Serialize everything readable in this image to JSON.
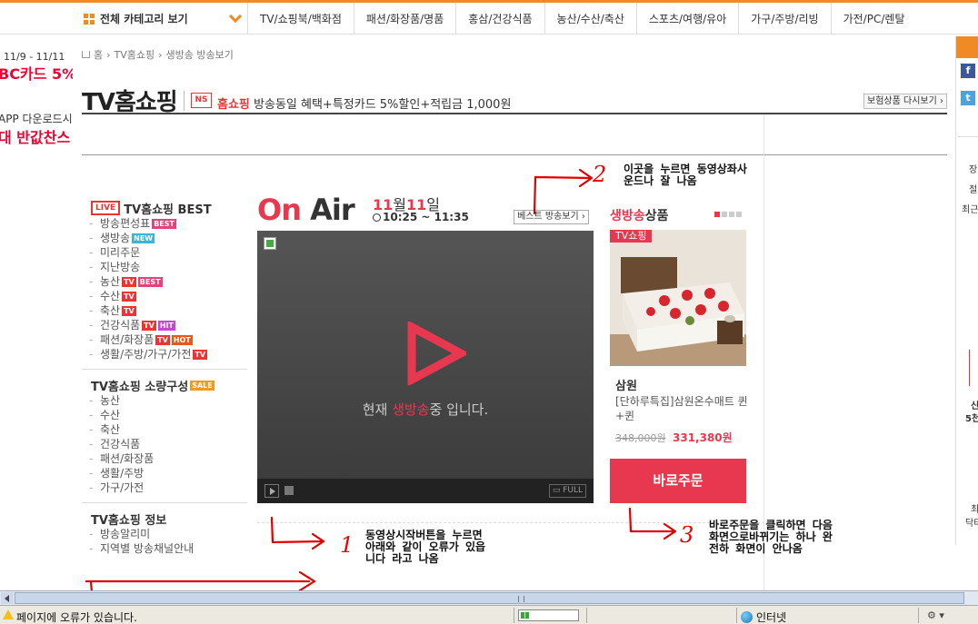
{
  "nav": {
    "all_categories": "전체 카테고리 보기",
    "items": [
      "TV/쇼핑북/백화점",
      "패션/화장품/명품",
      "홍삼/건강식품",
      "농산/수산/축산",
      "스포츠/여행/유아",
      "가구/주방/리빙",
      "가전/PC/렌탈"
    ]
  },
  "left_banner": {
    "line1": "11/9 - 11/11",
    "line2": "BC카드 5%",
    "line3": "APP 다운로드시",
    "line4": "대 반값찬스"
  },
  "breadcrumb": {
    "home": "홈",
    "level1": "TV홈쇼핑",
    "level2": "생방송 방송보기"
  },
  "header": {
    "title": "TV홈쇼핑",
    "logo_text": "NS",
    "brand": "홈쇼핑",
    "promo": "방송동일 혜택+특정카드 5%할인+적립금 1,000원",
    "insurance_button": "보험상품 다시보기"
  },
  "left_menu": {
    "best_badge": "LIVE",
    "best_title": "TV홈쇼핑 BEST",
    "best_items": [
      {
        "label": "방송편성표",
        "tags": [
          "BEST"
        ]
      },
      {
        "label": "생방송",
        "tags": [
          "NEW"
        ]
      },
      {
        "label": "미리주문",
        "tags": []
      },
      {
        "label": "지난방송",
        "tags": []
      },
      {
        "label": "농산",
        "tags": [
          "TV",
          "BEST"
        ]
      },
      {
        "label": "수산",
        "tags": [
          "TV"
        ]
      },
      {
        "label": "축산",
        "tags": [
          "TV"
        ]
      },
      {
        "label": "건강식품",
        "tags": [
          "TV",
          "HIT"
        ]
      },
      {
        "label": "패션/화장품",
        "tags": [
          "TV",
          "HOT"
        ]
      },
      {
        "label": "생활/주방/가구/가전",
        "tags": [
          "TV"
        ]
      }
    ],
    "small_title": "TV홈쇼핑 소량구성",
    "small_tag": "SALE",
    "small_items": [
      "농산",
      "수산",
      "축산",
      "건강식품",
      "패션/화장품",
      "생활/주방",
      "가구/가전"
    ],
    "info_title": "TV홈쇼핑 정보",
    "info_items": [
      "방송알리미",
      "지역별 방송채널안내"
    ]
  },
  "onair": {
    "on": "On",
    "air": "Air",
    "month": "11",
    "month_unit": "월",
    "day": "11",
    "day_unit": "일",
    "time": "10:25 ~ 11:35",
    "best_button": "베스트 방송보기"
  },
  "video": {
    "msg_prefix": "현재 ",
    "msg_live": "생방송",
    "msg_suffix": "중 입니다.",
    "full_label": "FULL"
  },
  "live_product": {
    "head_red": "생방송",
    "head_rest": "상품",
    "tv_tag": "TV쇼핑",
    "brand": "삼원",
    "name": "[단하루특집]삼원온수매트 퀸+퀸",
    "orig_price": "348,000원",
    "sale_price": "331,380원",
    "order_button": "바로주문"
  },
  "right_panel": {
    "t1": "장",
    "t2": "절",
    "t3": "최근",
    "t4": "신",
    "t5": "5천",
    "t6": "최",
    "t7": "닥터"
  },
  "annotations": {
    "n1": "1",
    "n2": "2",
    "n3": "3",
    "note2": "이곳을 누르면 동영상좌사\n운드나 잘 나옴",
    "note1": "동영상시작버튼을 누르면\n아래와 같이 오류가 있읍\n니다 라고 나옴",
    "note3": "바로주문을 클릭하면 다음\n화면으로바뀌기는 하나 완\n전하 화면이 안나옴"
  },
  "statusbar": {
    "text": "페이지에 오류가 있습니다.",
    "zone": "인터넷"
  },
  "colors": {
    "accent": "#f08a24",
    "live_red": "#e8384f",
    "annotation_red": "#e00000"
  }
}
